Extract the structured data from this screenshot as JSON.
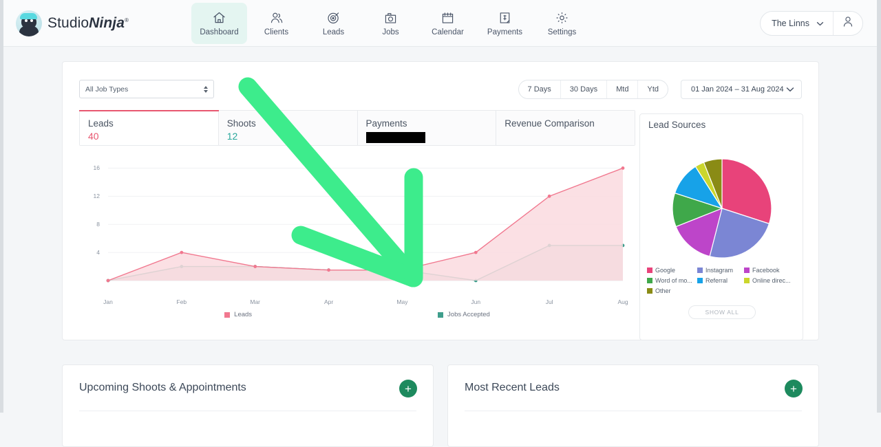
{
  "brand": {
    "name_light": "Studio",
    "name_bold": "Ninja",
    "registered": "®"
  },
  "nav": {
    "items": [
      {
        "label": "Dashboard",
        "icon": "home-icon",
        "active": true
      },
      {
        "label": "Clients",
        "icon": "clients-icon",
        "active": false
      },
      {
        "label": "Leads",
        "icon": "target-icon",
        "active": false
      },
      {
        "label": "Jobs",
        "icon": "camera-icon",
        "active": false
      },
      {
        "label": "Calendar",
        "icon": "calendar-icon",
        "active": false
      },
      {
        "label": "Payments",
        "icon": "invoice-icon",
        "active": false
      },
      {
        "label": "Settings",
        "icon": "gear-icon",
        "active": false
      }
    ]
  },
  "user": {
    "name": "The Linns"
  },
  "filters": {
    "job_type": {
      "value": "All Job Types"
    },
    "ranges": [
      "7 Days",
      "30 Days",
      "Mtd",
      "Ytd"
    ],
    "date_range": "01 Jan 2024 – 31 Aug 2024"
  },
  "stat_tabs": [
    {
      "label": "Leads",
      "value": "40",
      "active": true,
      "redacted": false
    },
    {
      "label": "Shoots",
      "value": "12",
      "active": false,
      "redacted": false
    },
    {
      "label": "Payments",
      "value": "",
      "active": false,
      "redacted": true
    },
    {
      "label": "Revenue Comparison",
      "value": "",
      "active": false,
      "redacted": false
    }
  ],
  "lead_sources": {
    "title": "Lead Sources",
    "show_all_label": "SHOW ALL"
  },
  "bottom_cards": [
    {
      "title": "Upcoming Shoots & Appointments",
      "add_icon": "plus-icon"
    },
    {
      "title": "Most Recent Leads",
      "add_icon": "plus-icon"
    }
  ],
  "colors": {
    "leads": "#f1788f",
    "leads_fill": "#fadadf",
    "jobs": "#3f9e8c",
    "jobs_fill": "#cfd8d5",
    "accent_red": "#e8566f",
    "accent_teal": "#26a69a",
    "nav_active_bg": "#e4f5f1",
    "annotation_green": "#3dec8c",
    "add_green": "#1d8a5e"
  },
  "chart_data": [
    {
      "type": "area",
      "title": "",
      "xlabel": "",
      "ylabel": "",
      "x": [
        "Jan",
        "Feb",
        "Mar",
        "Apr",
        "May",
        "Jun",
        "Jul",
        "Aug"
      ],
      "ylim": [
        0,
        18
      ],
      "yticks": [
        4,
        8,
        12,
        16
      ],
      "grid": true,
      "legend_position": "bottom",
      "series": [
        {
          "name": "Leads",
          "color": "#f1788f",
          "values": [
            0,
            4,
            2,
            1.5,
            1.5,
            4,
            12,
            16
          ]
        },
        {
          "name": "Jobs Accepted",
          "color": "#3f9e8c",
          "values": [
            0,
            2,
            2,
            1.5,
            1.5,
            0,
            5,
            5
          ]
        }
      ]
    },
    {
      "type": "pie",
      "title": "Lead Sources",
      "legend_position": "bottom",
      "labels": [
        "Google",
        "Instagram",
        "Facebook",
        "Word of mo...",
        "Referral",
        "Online direc...",
        "Other"
      ],
      "values": [
        30,
        24,
        15,
        11,
        11,
        3,
        6
      ],
      "colors": [
        "#e8437a",
        "#7b86d4",
        "#bd45c9",
        "#3fa84a",
        "#17a2e8",
        "#cbd62c",
        "#8a8b15"
      ]
    }
  ]
}
